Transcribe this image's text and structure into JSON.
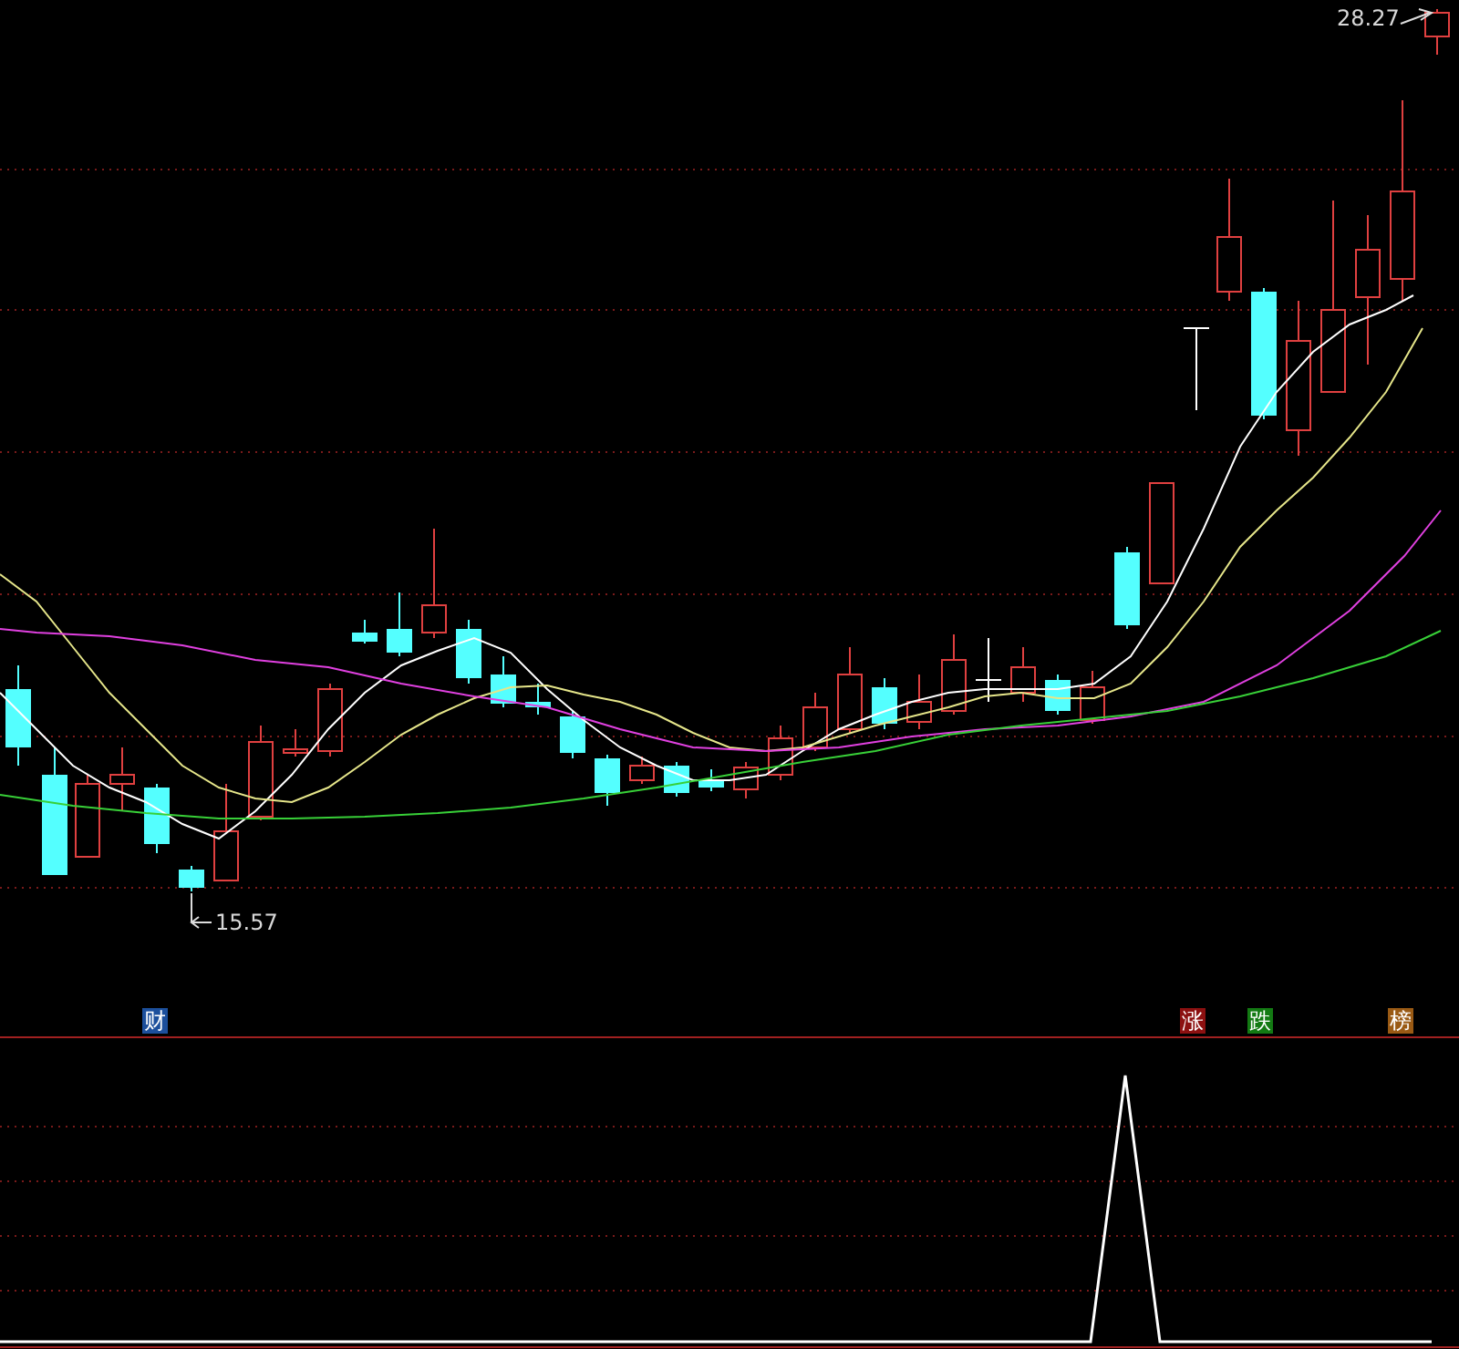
{
  "price_chart": {
    "high_label": "28.27",
    "low_label": "15.57"
  },
  "tags": [
    {
      "text": "财",
      "color": "#1c4f9c"
    },
    {
      "text": "涨",
      "color": "#8c1010"
    },
    {
      "text": "跌",
      "color": "#137a13"
    },
    {
      "text": "榜",
      "color": "#9a5a14"
    }
  ]
}
